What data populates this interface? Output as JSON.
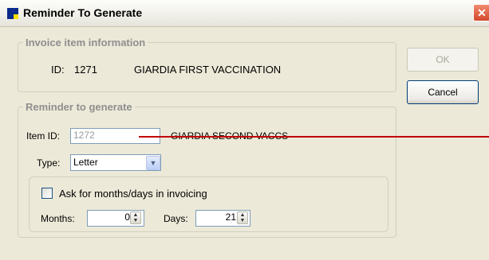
{
  "window": {
    "title": "Reminder To Generate",
    "close_glyph": "✕"
  },
  "invoice_group": {
    "legend": "Invoice item information",
    "id_label": "ID:",
    "id_value": "1271",
    "description": "GIARDIA FIRST VACCINATION"
  },
  "buttons": {
    "ok": "OK",
    "cancel": "Cancel"
  },
  "reminder_group": {
    "legend": "Reminder to generate",
    "item_id_label": "Item ID:",
    "item_id_value": "1272",
    "item_description": "GIARDIA SECOND VACCS",
    "type_label": "Type:",
    "type_value": "Letter",
    "ask_label": "Ask for months/days in invoicing",
    "ask_checked": false,
    "months_label": "Months:",
    "months_value": "0",
    "days_label": "Days:",
    "days_value": "21"
  },
  "colors": {
    "annotation_line": "#c00000",
    "window_bg": "#ece9d8"
  }
}
